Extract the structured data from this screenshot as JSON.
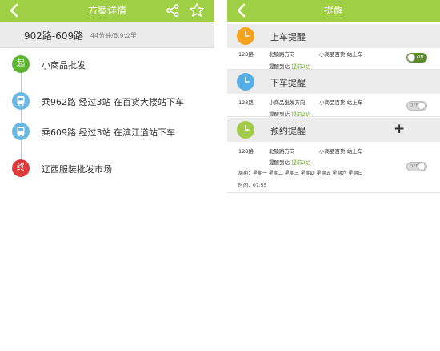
{
  "left_screen": {
    "title": "方案详情",
    "route_name": "902路-609路",
    "route_meta": "44分钟/6.9公里",
    "steps": [
      {
        "icon": "起",
        "text": "小商品批发"
      },
      {
        "icon": "bus-icon",
        "text": "乘962路 经过3站  在百货大楼站下车"
      },
      {
        "icon": "bus-icon",
        "text": "乘609路 经过3站  在滨江道站下车"
      },
      {
        "icon": "终",
        "text": "辽西服装批发市场"
      }
    ]
  },
  "right_screen": {
    "title": "提醒",
    "sections": [
      {
        "title": "上车提醒",
        "route": "128路",
        "direction": "北镇路方向",
        "station": "小商品百货 站上车",
        "remind_prefix": "提醒到站-",
        "remind_value": "提前2站",
        "toggle": "ON"
      },
      {
        "title": "下车提醒",
        "route": "128路",
        "direction": "小商品批发方向",
        "station": "小商品百货 站上车",
        "remind_prefix": "提醒到站-",
        "remind_value": "提前2站",
        "toggle": "OFF"
      },
      {
        "title": "预约提醒",
        "route": "128路",
        "direction": "北镇路方向",
        "station": "小商品百货 站上车",
        "remind_prefix": "提醒到站-",
        "remind_value": "提前2站",
        "toggle": "OFF",
        "cycle": "周期：星期一 星期二 星期三 星期四 星期五 星期六 星期日",
        "time": "时间：07:55"
      }
    ]
  },
  "colors": {
    "header_green": "#9fcf45",
    "start_green": "#5cb531",
    "bus_blue": "#6ab9e3",
    "end_red": "#de3a3a",
    "clock_orange": "#f5a21d",
    "clock_blue": "#55aee6",
    "clock_green": "#a1cb48",
    "toggle_on": "#5d8a2f"
  }
}
